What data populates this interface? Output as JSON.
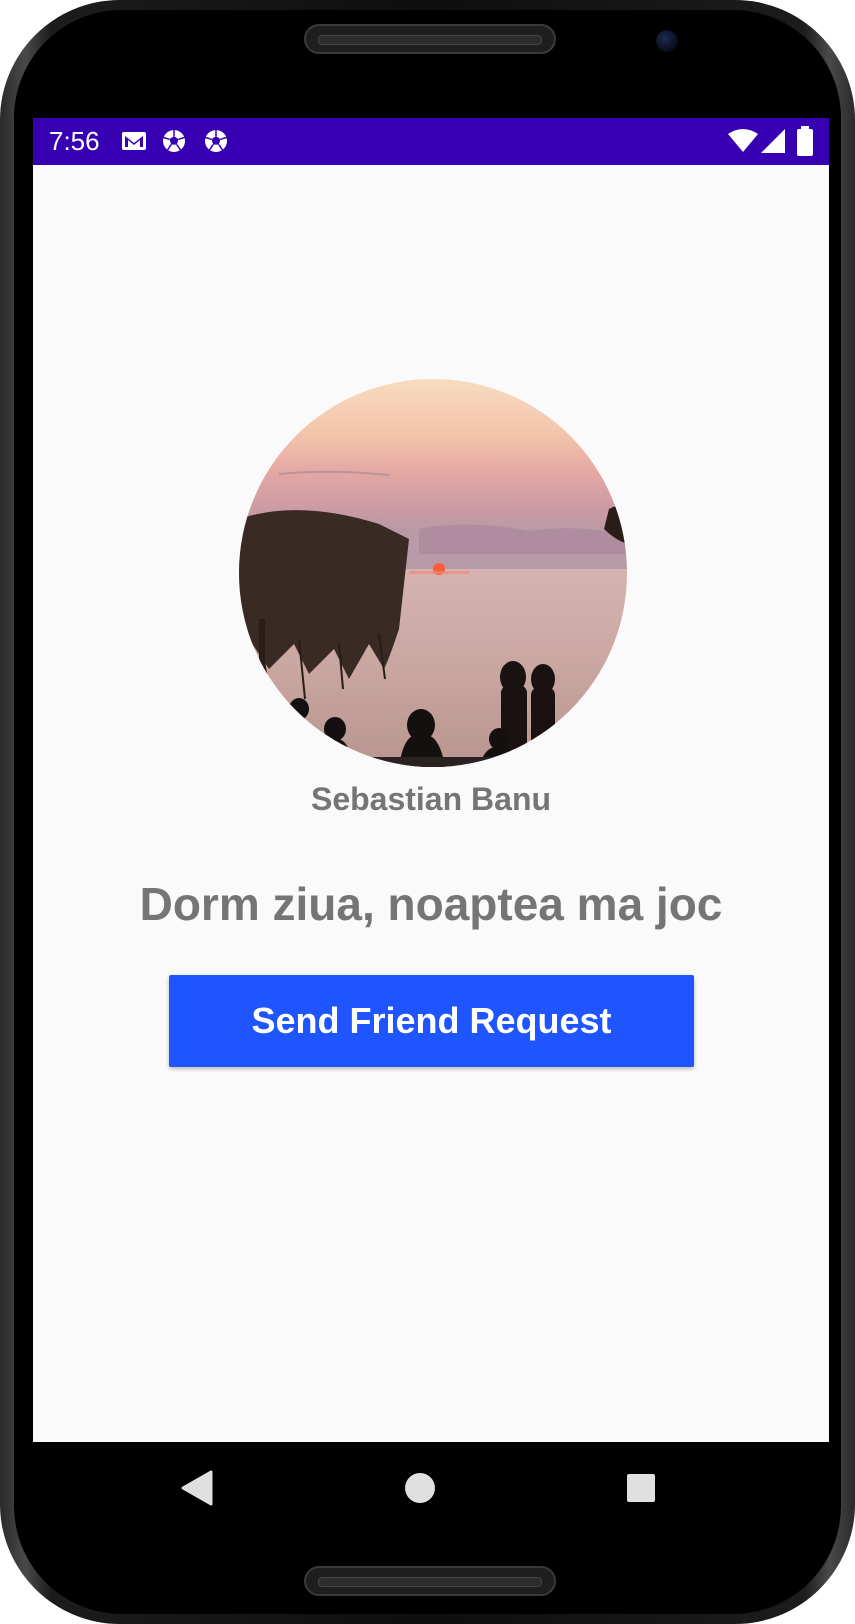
{
  "status_bar": {
    "time": "7:56",
    "left_icons": [
      "gmail-icon",
      "soccer-ball-icon",
      "soccer-ball-icon"
    ],
    "right_icons": [
      "wifi-icon",
      "cellular-signal-icon",
      "battery-icon"
    ],
    "color": "#3700b3"
  },
  "profile": {
    "avatar_icon": "profile-photo-sunset-beach",
    "name": "Sebastian Banu",
    "status": "Dorm ziua, noaptea ma joc"
  },
  "actions": {
    "friend_request_label": "Send Friend Request",
    "button_color": "#1e55ff"
  },
  "navigation": {
    "back_icon": "back-triangle-icon",
    "home_icon": "home-circle-icon",
    "recents_icon": "recents-square-icon"
  }
}
